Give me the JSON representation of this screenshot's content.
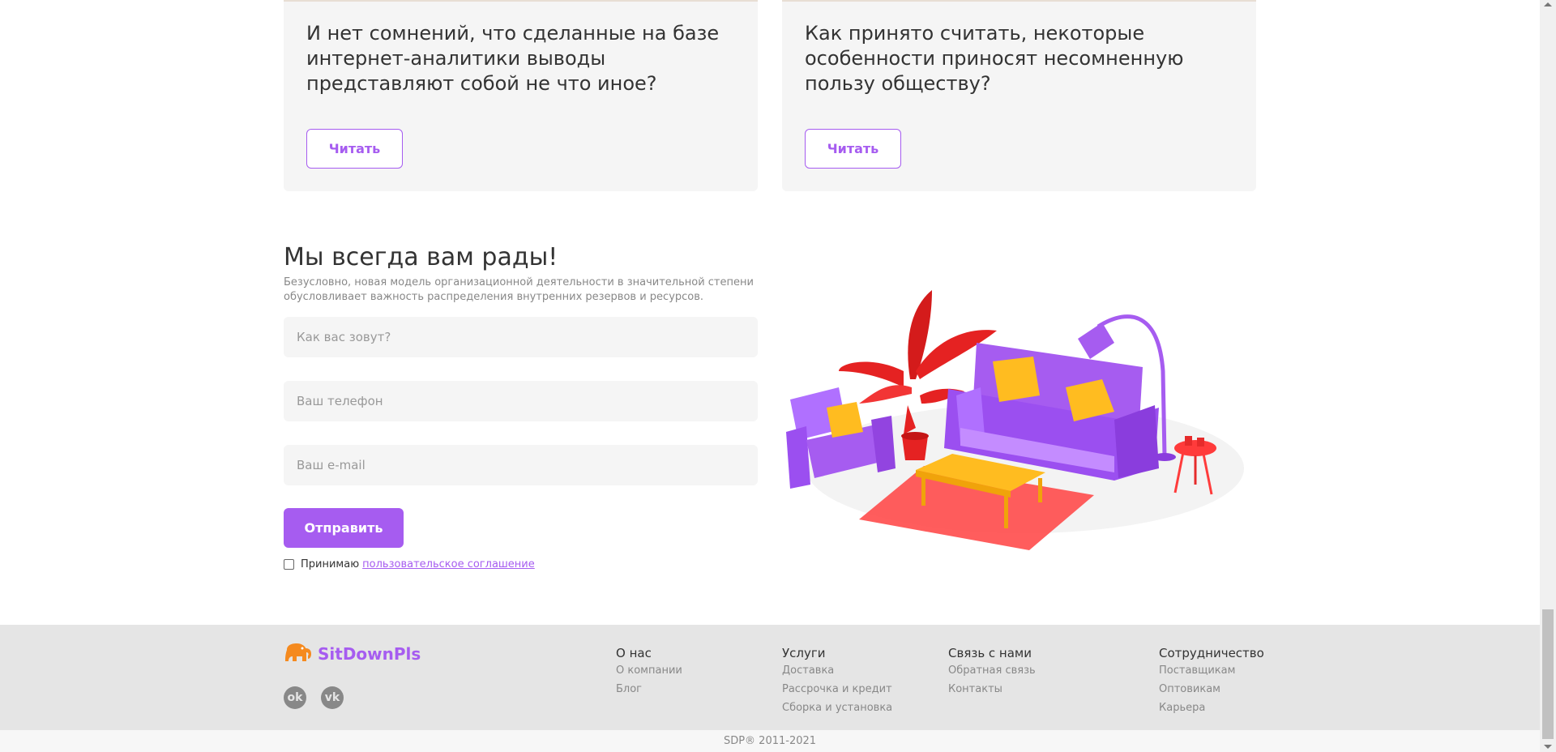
{
  "cards": [
    {
      "title": "И нет сомнений, что сделанные на базе интернет-аналитики выводы представляют собой не что иное?",
      "button": "Читать"
    },
    {
      "title": "Как принято считать, некоторые особенности приносят несомненную пользу обществу?",
      "button": "Читать"
    }
  ],
  "form": {
    "title": "Мы всегда вам рады!",
    "description": "Безусловно, новая модель организационной деятельности в значительной степени обусловливает важность распределения внутренних резервов и ресурсов.",
    "name_placeholder": "Как вас зовут?",
    "phone_placeholder": "Ваш телефон",
    "email_placeholder": "Ваш e-mail",
    "submit": "Отправить",
    "agree_text": "Принимаю",
    "agree_link": "пользовательское соглашение"
  },
  "footer": {
    "logo": "SitDownPls",
    "social": [
      "odnoklassniki-icon",
      "vk-icon"
    ],
    "columns": [
      {
        "title": "О нас",
        "links": [
          "О компании",
          "Блог"
        ]
      },
      {
        "title": "Услуги",
        "links": [
          "Доставка",
          "Рассрочка и кредит",
          "Сборка и установка"
        ]
      },
      {
        "title": "Связь с нами",
        "links": [
          "Обратная связь",
          "Контакты"
        ]
      },
      {
        "title": "Сотрудничество",
        "links": [
          "Поставщикам",
          "Оптовикам",
          "Карьера"
        ]
      }
    ],
    "copyright": "SDP®   2011-2021"
  },
  "colors": {
    "accent": "#a65cf0",
    "logo_orange": "#f58a1f"
  }
}
